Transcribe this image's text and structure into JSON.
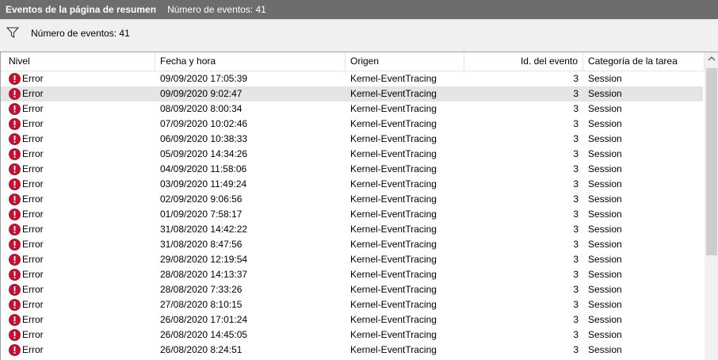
{
  "title": "Eventos de la página de resumen",
  "title_count": "Número de eventos: 41",
  "filter_text": "Número de eventos: 41",
  "columns": [
    "Nivel",
    "Fecha y hora",
    "Origen",
    "Id. del evento",
    "Categoría de la tarea"
  ],
  "selected_row": 1,
  "colors": {
    "titlebar": "#6d6d6d",
    "error_icon": "#c8102e",
    "selected_row": "#e5e5e5"
  },
  "rows": [
    {
      "level": "Error",
      "date": "09/09/2020 17:05:39",
      "source": "Kernel-EventTracing",
      "id": "3",
      "category": "Session"
    },
    {
      "level": "Error",
      "date": "09/09/2020 9:02:47",
      "source": "Kernel-EventTracing",
      "id": "3",
      "category": "Session"
    },
    {
      "level": "Error",
      "date": "08/09/2020 8:00:34",
      "source": "Kernel-EventTracing",
      "id": "3",
      "category": "Session"
    },
    {
      "level": "Error",
      "date": "07/09/2020 10:02:46",
      "source": "Kernel-EventTracing",
      "id": "3",
      "category": "Session"
    },
    {
      "level": "Error",
      "date": "06/09/2020 10:38:33",
      "source": "Kernel-EventTracing",
      "id": "3",
      "category": "Session"
    },
    {
      "level": "Error",
      "date": "05/09/2020 14:34:26",
      "source": "Kernel-EventTracing",
      "id": "3",
      "category": "Session"
    },
    {
      "level": "Error",
      "date": "04/09/2020 11:58:06",
      "source": "Kernel-EventTracing",
      "id": "3",
      "category": "Session"
    },
    {
      "level": "Error",
      "date": "03/09/2020 11:49:24",
      "source": "Kernel-EventTracing",
      "id": "3",
      "category": "Session"
    },
    {
      "level": "Error",
      "date": "02/09/2020 9:06:56",
      "source": "Kernel-EventTracing",
      "id": "3",
      "category": "Session"
    },
    {
      "level": "Error",
      "date": "01/09/2020 7:58:17",
      "source": "Kernel-EventTracing",
      "id": "3",
      "category": "Session"
    },
    {
      "level": "Error",
      "date": "31/08/2020 14:42:22",
      "source": "Kernel-EventTracing",
      "id": "3",
      "category": "Session"
    },
    {
      "level": "Error",
      "date": "31/08/2020 8:47:56",
      "source": "Kernel-EventTracing",
      "id": "3",
      "category": "Session"
    },
    {
      "level": "Error",
      "date": "29/08/2020 12:19:54",
      "source": "Kernel-EventTracing",
      "id": "3",
      "category": "Session"
    },
    {
      "level": "Error",
      "date": "28/08/2020 14:13:37",
      "source": "Kernel-EventTracing",
      "id": "3",
      "category": "Session"
    },
    {
      "level": "Error",
      "date": "28/08/2020 7:33:26",
      "source": "Kernel-EventTracing",
      "id": "3",
      "category": "Session"
    },
    {
      "level": "Error",
      "date": "27/08/2020 8:10:15",
      "source": "Kernel-EventTracing",
      "id": "3",
      "category": "Session"
    },
    {
      "level": "Error",
      "date": "26/08/2020 17:01:24",
      "source": "Kernel-EventTracing",
      "id": "3",
      "category": "Session"
    },
    {
      "level": "Error",
      "date": "26/08/2020 14:45:05",
      "source": "Kernel-EventTracing",
      "id": "3",
      "category": "Session"
    },
    {
      "level": "Error",
      "date": "26/08/2020 8:24:51",
      "source": "Kernel-EventTracing",
      "id": "3",
      "category": "Session"
    }
  ]
}
